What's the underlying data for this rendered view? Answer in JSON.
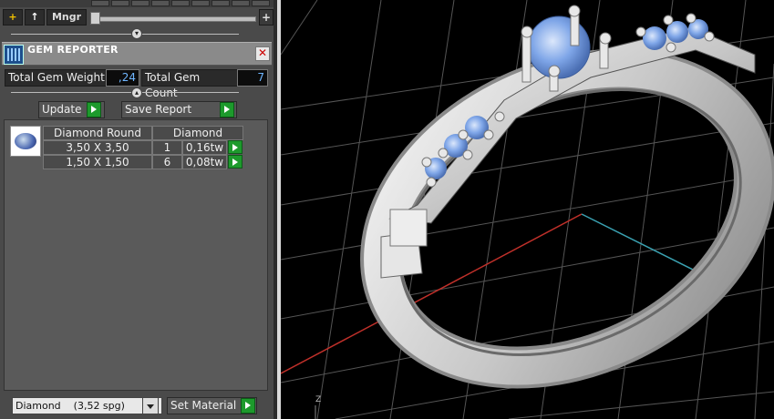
{
  "toolbar": {
    "mngr_label": "Mngr",
    "plus_label": "+",
    "up_label": "↑",
    "add_label": "+"
  },
  "header": {
    "title": "GEM REPORTER",
    "close_label": "✕"
  },
  "stats": {
    "weight_label": "Total Gem Weight",
    "weight_value": ",24",
    "count_label": "Total Gem Count",
    "count_value": "7"
  },
  "actions": {
    "update_label": "Update",
    "save_label": "Save Report"
  },
  "table": {
    "headers": [
      "Diamond Round",
      "Diamond"
    ],
    "rows": [
      {
        "size": "3,50 X 3,50",
        "count": "1",
        "weight": "0,16tw"
      },
      {
        "size": "1,50 X 1,50",
        "count": "6",
        "weight": "0,08tw"
      }
    ]
  },
  "material": {
    "selected": "Diamond    (3,52 spg)",
    "button_label": "Set Material"
  },
  "viewport": {
    "axis_label": "Z"
  },
  "colors": {
    "stone": "#7fa6e8",
    "metal": "#d8d8d8",
    "grid": "#555555",
    "x_axis": "#c0302a",
    "y_axis": "#3aa0b0"
  }
}
